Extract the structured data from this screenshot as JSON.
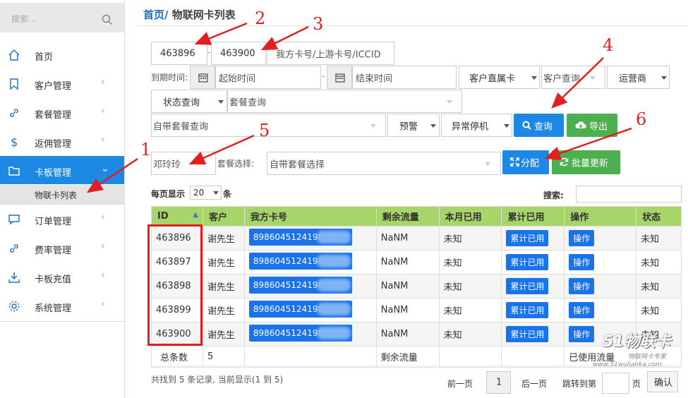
{
  "sidebar": {
    "search_placeholder": "搜索...",
    "items": [
      {
        "label": "首页",
        "icon": "home-icon"
      },
      {
        "label": "客户管理",
        "icon": "bookmark-icon"
      },
      {
        "label": "套餐管理",
        "icon": "link-icon"
      },
      {
        "label": "返佣管理",
        "icon": "dollar-icon"
      },
      {
        "label": "卡板管理",
        "icon": "folder-icon"
      },
      {
        "label": "订单管理",
        "icon": "comment-icon"
      },
      {
        "label": "费率管理",
        "icon": "link-icon"
      },
      {
        "label": "卡板充值",
        "icon": "download-icon"
      },
      {
        "label": "系统管理",
        "icon": "gear-icon"
      }
    ],
    "sub_item": "物联卡列表",
    "chevron": "‹",
    "chevron_down": "⌄"
  },
  "breadcrumb": {
    "home": "首页",
    "sep": "/",
    "current": "物联网卡列表"
  },
  "filters": {
    "id_start": "463896",
    "dash": "-",
    "id_end": "463900",
    "card_placeholder": "我方卡号/上游卡号/ICCID",
    "expire_label": "到期时间:",
    "start_time": "起始时间",
    "end_time": "结束时间",
    "direct_card": "客户直属卡",
    "customer_query": "客户查询",
    "operator": "运营商",
    "status_query": "状态查询",
    "package_query": "套餐查询",
    "own_package_query": "自带套餐查询",
    "warning": "预警",
    "abnormal_stop": "异常停机",
    "search_btn": "查询",
    "export_btn": "导出",
    "customer_select": "邓玲玲",
    "package_select_label": "套餐选择:",
    "package_select": "自带套餐选择",
    "assign_btn": "分配",
    "batch_update_btn": "批量更新"
  },
  "table_controls": {
    "per_page_prefix": "每页显示",
    "per_page": "20",
    "per_page_suffix": "条",
    "search_label": "搜索:"
  },
  "table": {
    "headers": [
      "ID",
      "客户",
      "我方卡号",
      "剩余流量",
      "本月已用",
      "累计已用",
      "操作",
      "状态"
    ],
    "rows": [
      {
        "id": "463896",
        "customer": "谢先生",
        "card": "8986045124198",
        "remaining": "NaNM",
        "month_used": "未知",
        "total_btn": "累计已用",
        "op_btn": "操作",
        "status": "未知"
      },
      {
        "id": "463897",
        "customer": "谢先生",
        "card": "8986045124198",
        "remaining": "NaNM",
        "month_used": "未知",
        "total_btn": "累计已用",
        "op_btn": "操作",
        "status": "未知"
      },
      {
        "id": "463898",
        "customer": "谢先生",
        "card": "8986045124198",
        "remaining": "NaNM",
        "month_used": "未知",
        "total_btn": "累计已用",
        "op_btn": "操作",
        "status": "未知"
      },
      {
        "id": "463899",
        "customer": "谢先生",
        "card": "8986045124198",
        "remaining": "NaNM",
        "month_used": "未知",
        "total_btn": "累计已用",
        "op_btn": "操作",
        "status": "未知"
      },
      {
        "id": "463900",
        "customer": "谢先生",
        "card": "8986045124198",
        "remaining": "NaNM",
        "month_used": "未知",
        "total_btn": "累计已用",
        "op_btn": "操作",
        "status": "未知"
      }
    ],
    "footer": {
      "total_label": "总条数",
      "total": "5",
      "remaining_label": "剩余流量",
      "used_label": "已使用流量"
    }
  },
  "pager": {
    "summary": "共找到 5 条记录, 当前显示(1 到 5)",
    "prev": "前一页",
    "page": "1",
    "next": "后一页",
    "jump": "跳转到第",
    "page_unit": "页",
    "confirm": "确认"
  },
  "annotations": [
    "1",
    "2",
    "3",
    "4",
    "5",
    "6"
  ],
  "watermark": {
    "logo": "51物联卡",
    "tagline": "物联网卡专家",
    "url": "www.51wulianka.com"
  },
  "colors": {
    "primary": "#1e88e5",
    "success": "#4caf50",
    "header_green": "#a8d56a",
    "annotation_red": "#e02020"
  }
}
